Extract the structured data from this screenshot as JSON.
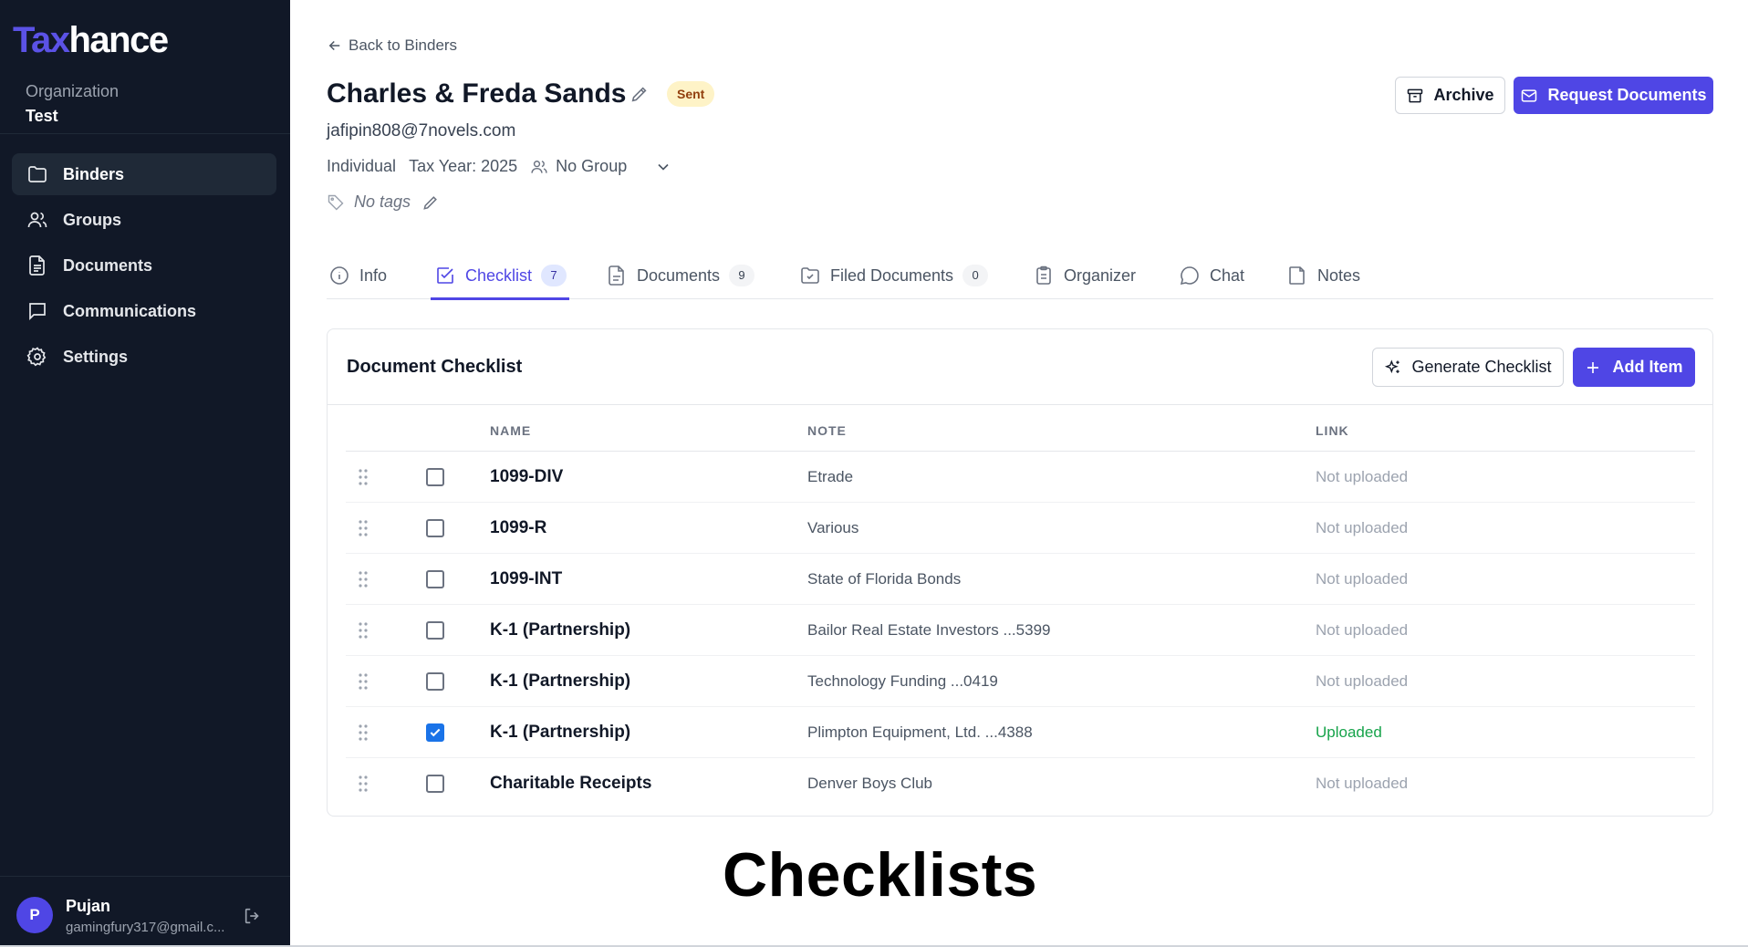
{
  "brand": {
    "part1": "Tax",
    "part2": "hance"
  },
  "organization": {
    "label": "Organization",
    "name": "Test"
  },
  "sidebar": {
    "items": [
      {
        "label": "Binders",
        "icon": "folder-icon"
      },
      {
        "label": "Groups",
        "icon": "users-icon"
      },
      {
        "label": "Documents",
        "icon": "document-icon"
      },
      {
        "label": "Communications",
        "icon": "message-icon"
      },
      {
        "label": "Settings",
        "icon": "gear-icon"
      }
    ]
  },
  "user": {
    "initial": "P",
    "name": "Pujan",
    "email": "gamingfury317@gmail.c..."
  },
  "header": {
    "back_label": "Back to Binders",
    "title": "Charles & Freda Sands",
    "status": "Sent",
    "email": "jafipin808@7novels.com",
    "type": "Individual",
    "tax_year": "Tax Year: 2025",
    "group": "No Group",
    "tags": "No tags"
  },
  "actions": {
    "archive": "Archive",
    "request": "Request Documents"
  },
  "tabs": [
    {
      "label": "Info",
      "count": null
    },
    {
      "label": "Checklist",
      "count": "7"
    },
    {
      "label": "Documents",
      "count": "9"
    },
    {
      "label": "Filed Documents",
      "count": "0"
    },
    {
      "label": "Organizer",
      "count": null
    },
    {
      "label": "Chat",
      "count": null
    },
    {
      "label": "Notes",
      "count": null
    }
  ],
  "checklist": {
    "title": "Document Checklist",
    "generate_label": "Generate Checklist",
    "add_label": "Add Item",
    "columns": {
      "name": "NAME",
      "note": "NOTE",
      "link": "LINK"
    },
    "rows": [
      {
        "name": "1099-DIV",
        "note": "Etrade",
        "link": "Not uploaded",
        "checked": false
      },
      {
        "name": "1099-R",
        "note": "Various",
        "link": "Not uploaded",
        "checked": false
      },
      {
        "name": "1099-INT",
        "note": "State of Florida Bonds",
        "link": "Not uploaded",
        "checked": false
      },
      {
        "name": "K-1 (Partnership)",
        "note": "Bailor Real Estate Investors ...5399",
        "link": "Not uploaded",
        "checked": false
      },
      {
        "name": "K-1 (Partnership)",
        "note": "Technology Funding ...0419",
        "link": "Not uploaded",
        "checked": false
      },
      {
        "name": "K-1 (Partnership)",
        "note": "Plimpton Equipment, Ltd. ...4388",
        "link": "Uploaded",
        "checked": true
      },
      {
        "name": "Charitable Receipts",
        "note": "Denver Boys Club",
        "link": "Not uploaded",
        "checked": false
      }
    ]
  },
  "caption": "Checklists",
  "colors": {
    "accent": "#4f46e5",
    "sidebar": "#111827",
    "uploaded": "#16a34a",
    "badge_bg": "#fef3c7"
  }
}
